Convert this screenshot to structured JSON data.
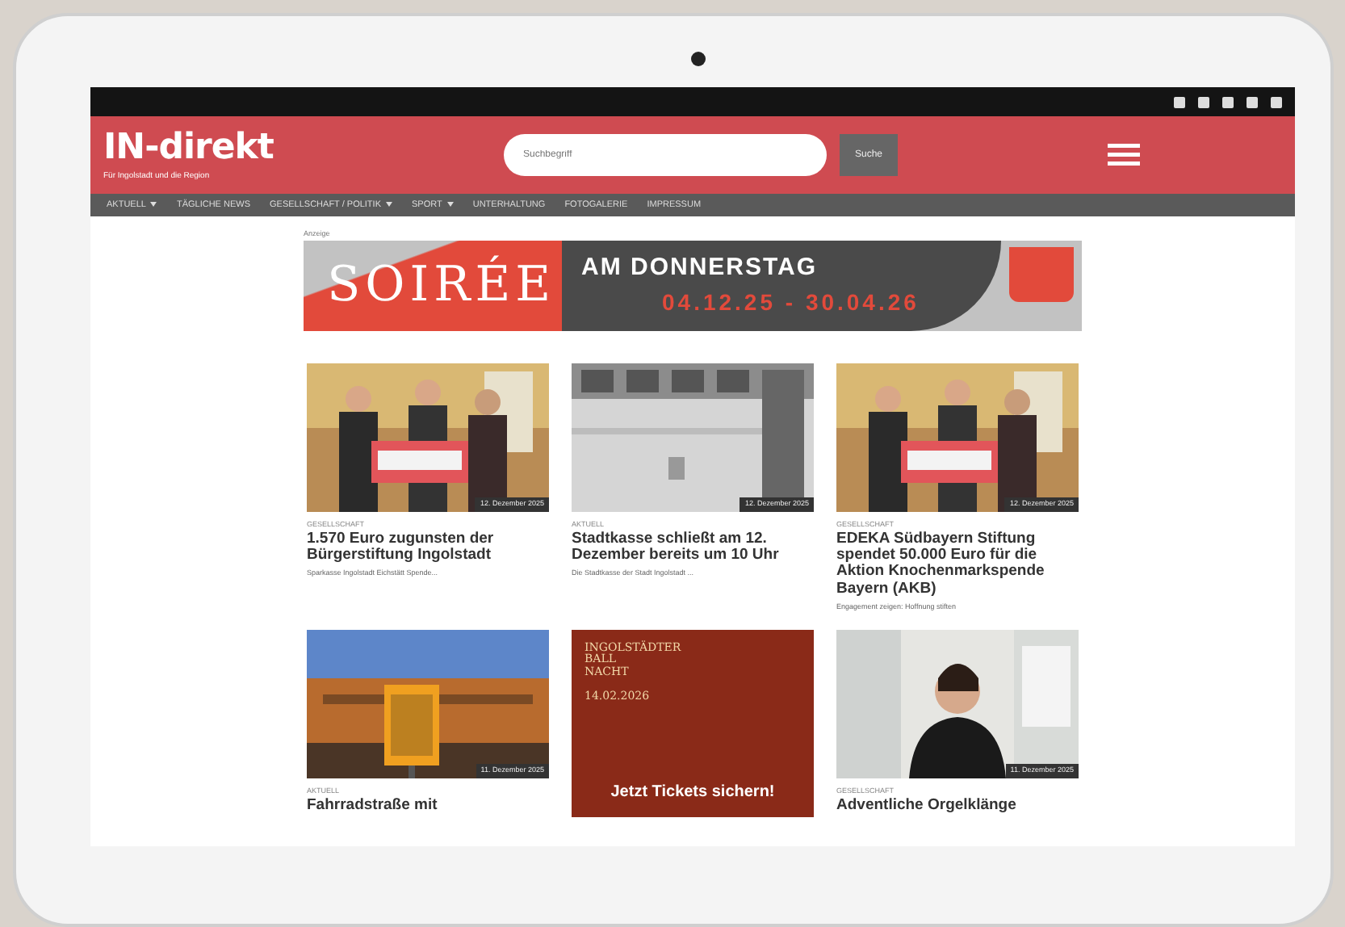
{
  "header": {
    "logo": "IN-direkt",
    "tagline": "Für Ingolstadt und die Region",
    "search": {
      "placeholder": "Suchbegriff"
    },
    "search_button": "Suche"
  },
  "nav": [
    {
      "label": "AKTUELL",
      "dropdown": true
    },
    {
      "label": "TÄGLICHE NEWS",
      "dropdown": false
    },
    {
      "label": "GESELLSCHAFT / POLITIK",
      "dropdown": true
    },
    {
      "label": "SPORT",
      "dropdown": true
    },
    {
      "label": "UNTERHALTUNG",
      "dropdown": false
    },
    {
      "label": "FOTOGALERIE",
      "dropdown": false
    },
    {
      "label": "IMPRESSUM",
      "dropdown": false
    }
  ],
  "banner": {
    "label": "Anzeige",
    "headline": "SOIRÉE",
    "subline": "AM DONNERSTAG",
    "dates": "04.12.25 - 30.04.26"
  },
  "tiles": [
    {
      "kind": "article",
      "date": "12. Dezember 2025",
      "category": "GESELLSCHAFT",
      "title": "1.570 Euro zugunsten der Bürgerstiftung Ingolstadt",
      "excerpt": "Sparkasse Ingolstadt Eichstätt Spende..."
    },
    {
      "kind": "article",
      "date": "12. Dezember 2025",
      "category": "AKTUELL",
      "title": "Stadtkasse schließt am 12. Dezember bereits um 10 Uhr",
      "excerpt": "Die Stadtkasse der Stadt Ingolstadt ..."
    },
    {
      "kind": "article",
      "date": "12. Dezember 2025",
      "category": "GESELLSCHAFT",
      "title": "EDEKA Südbayern Stiftung spendet 50.000 Euro für die Aktion Knochenmarkspende Bayern (AKB)",
      "excerpt": "Engagement zeigen: Hoffnung stiften"
    },
    {
      "kind": "article",
      "date": "11. Dezember 2025",
      "category": "AKTUELL",
      "title": "Fahrradstraße mit"
    },
    {
      "kind": "ad",
      "lines": [
        "INGOLSTÄDTER",
        "BALL",
        "NACHT"
      ],
      "date": "14.02.2026",
      "cta": "Jetzt Tickets sichern!"
    },
    {
      "kind": "article",
      "date": "11. Dezember 2025",
      "category": "GESELLSCHAFT",
      "title": "Adventliche Orgelklänge"
    }
  ]
}
